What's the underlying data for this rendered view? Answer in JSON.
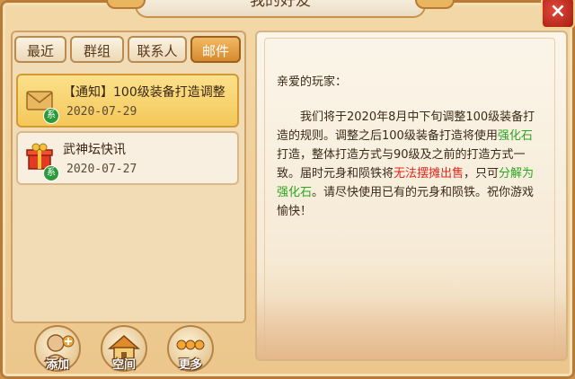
{
  "window": {
    "title": "我的好友",
    "close_label": "×"
  },
  "tabs": [
    {
      "label": "最近",
      "active": false
    },
    {
      "label": "群组",
      "active": false
    },
    {
      "label": "联系人",
      "active": false
    },
    {
      "label": "邮件",
      "active": true
    }
  ],
  "mail_list": [
    {
      "title": "【通知】100级装备打造调整",
      "date": "2020-07-29",
      "icon": "envelope-icon",
      "badge": "系",
      "selected": true
    },
    {
      "title": "武神坛快讯",
      "date": "2020-07-27",
      "icon": "gift-box-icon",
      "badge": "系",
      "selected": false
    }
  ],
  "bottom_buttons": [
    {
      "label": "添加",
      "icon": "add-friend-icon"
    },
    {
      "label": "空间",
      "icon": "house-icon"
    },
    {
      "label": "更多",
      "icon": "more-dots-icon"
    }
  ],
  "mail": {
    "greeting": "亲爱的玩家：",
    "body_part1": "我们将于2020年8月中下旬调整100级装备打造的规则。调整之后100级装备打造将使用",
    "highlight1": "强化石",
    "body_part2": "打造，整体打造方式与90级及之前的打造方式一致。届时元身和陨铁将",
    "highlight2": "无法摆摊出售",
    "body_part3": "，只可",
    "highlight3": "分解为强化石",
    "body_part4": "。请尽快使用已有的元身和陨铁。祝你游戏愉快！"
  },
  "colors": {
    "accent_orange": "#d68a2d",
    "highlight_green": "#2aa61f",
    "highlight_red": "#e2261b",
    "close_red": "#c2261b"
  }
}
